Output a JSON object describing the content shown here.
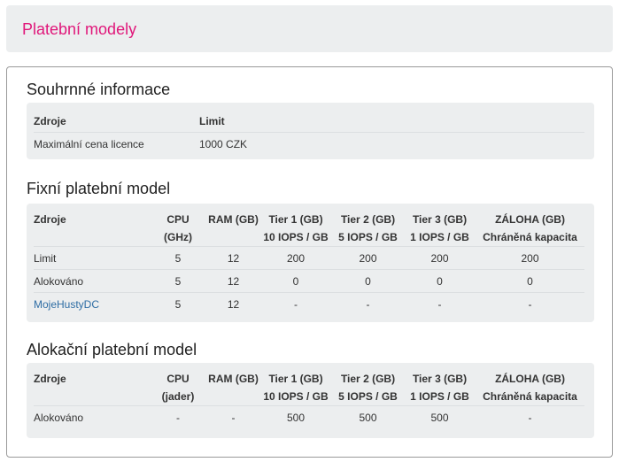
{
  "header": {
    "title": "Platební modely"
  },
  "summary": {
    "title": "Souhrnné informace",
    "columns": [
      "Zdroje",
      "Limit"
    ],
    "rows": [
      [
        "Maximální cena licence",
        "1000 CZK"
      ]
    ]
  },
  "fixed": {
    "title": "Fixní platební model",
    "columns": [
      {
        "l1": "Zdroje",
        "l2": ""
      },
      {
        "l1": "CPU",
        "l2": "(GHz)"
      },
      {
        "l1": "RAM (GB)",
        "l2": ""
      },
      {
        "l1": "Tier 1 (GB)",
        "l2": "10 IOPS / GB"
      },
      {
        "l1": "Tier 2 (GB)",
        "l2": "5 IOPS / GB"
      },
      {
        "l1": "Tier 3 (GB)",
        "l2": "1 IOPS / GB"
      },
      {
        "l1": "ZÁLOHA (GB)",
        "l2": "Chráněná kapacita"
      }
    ],
    "rows": [
      [
        "Limit",
        "5",
        "12",
        "200",
        "200",
        "200",
        "200"
      ],
      [
        "Alokováno",
        "5",
        "12",
        "0",
        "0",
        "0",
        "0"
      ],
      [
        "MojeHustyDC",
        "5",
        "12",
        "-",
        "-",
        "-",
        "-"
      ]
    ]
  },
  "allocation": {
    "title": "Alokační platební model",
    "columns": [
      {
        "l1": "Zdroje",
        "l2": ""
      },
      {
        "l1": "CPU",
        "l2": "(jader)"
      },
      {
        "l1": "RAM (GB)",
        "l2": ""
      },
      {
        "l1": "Tier 1 (GB)",
        "l2": "10 IOPS / GB"
      },
      {
        "l1": "Tier 2 (GB)",
        "l2": "5 IOPS / GB"
      },
      {
        "l1": "Tier 3 (GB)",
        "l2": "1 IOPS / GB"
      },
      {
        "l1": "ZÁLOHA (GB)",
        "l2": "Chráněná kapacita"
      }
    ],
    "rows": [
      [
        "Alokováno",
        "-",
        "-",
        "500",
        "500",
        "500",
        "-"
      ]
    ]
  },
  "colors": {
    "title_accent": "#e0177a",
    "link": "#2e6da4",
    "panel_bg": "#eceeef"
  }
}
